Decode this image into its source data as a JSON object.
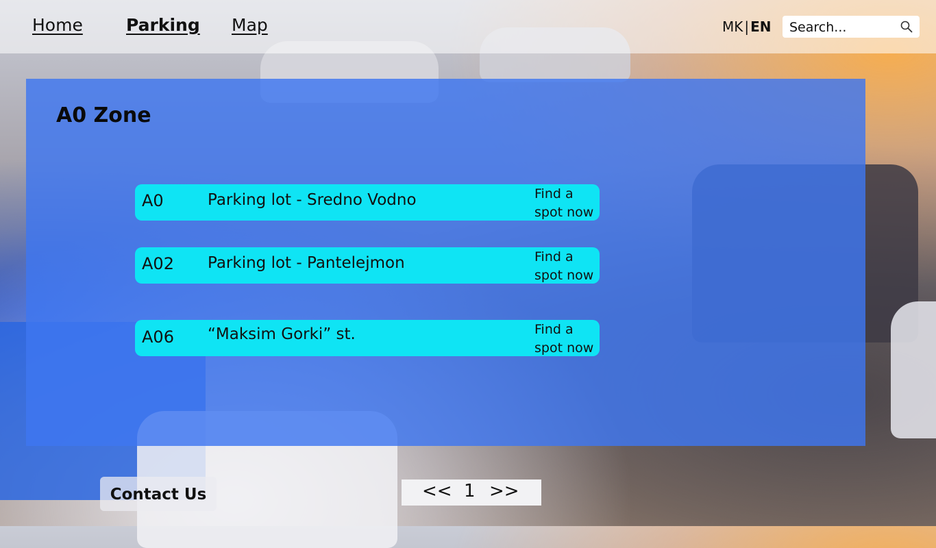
{
  "nav": {
    "home": "Home",
    "parking": "Parking",
    "map": "Map"
  },
  "language": {
    "mk": "MK",
    "separator": "|",
    "en": "EN",
    "active": "EN"
  },
  "search": {
    "placeholder": "Search...",
    "icon": "search-icon"
  },
  "zone": {
    "title": "A0 Zone",
    "lots": [
      {
        "code": "A0",
        "name": "Parking lot - Sredno Vodno",
        "action": "Find a spot now"
      },
      {
        "code": "A02",
        "name": "Parking lot - Pantelejmon",
        "action": "Find a spot now"
      },
      {
        "code": "A06",
        "name": "“Maksim Gorki” st.",
        "action": "Find a spot now"
      }
    ]
  },
  "footer": {
    "contact": "Contact Us",
    "pagination": {
      "prev": "<<",
      "current": "1",
      "next": ">>"
    }
  },
  "colors": {
    "panel": "#3e76f0",
    "row": "#0fe4f4",
    "text": "#111111"
  }
}
